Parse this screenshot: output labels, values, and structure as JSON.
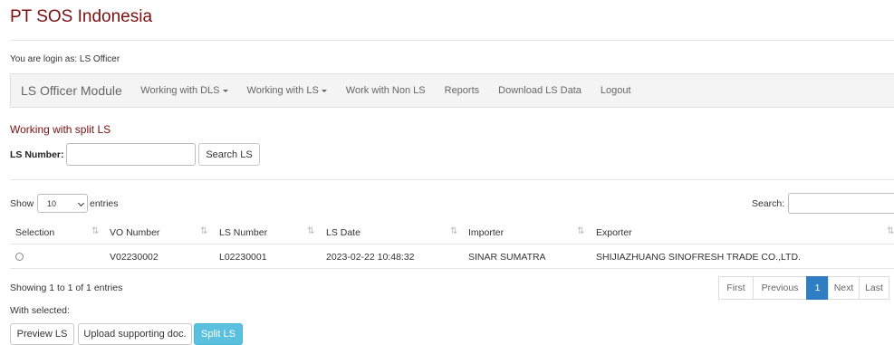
{
  "header": {
    "brand": "PT SOS Indonesia",
    "login_text": "You are login as: LS Officer"
  },
  "nav": {
    "module": "LS Officer Module",
    "items": [
      "Working with DLS",
      "Working with LS",
      "Work with Non LS",
      "Reports",
      "Download LS Data",
      "Logout"
    ]
  },
  "section": {
    "title": "Working with split LS"
  },
  "search_form": {
    "label": "LS Number:",
    "value": "",
    "button": "Search LS"
  },
  "table_controls": {
    "show_label": "Show",
    "page_size": "10",
    "entries_label": "entries",
    "search_label": "Search:",
    "search_value": ""
  },
  "table": {
    "columns": [
      "Selection",
      "VO Number",
      "LS Number",
      "LS Date",
      "Importer",
      "Exporter"
    ],
    "rows": [
      {
        "vo_number": "V02230002",
        "ls_number": "L02230001",
        "ls_date": "2023-02-22 10:48:32",
        "importer": "SINAR SUMATRA",
        "exporter": "SHIJIAZHUANG SINOFRESH TRADE CO.,LTD."
      }
    ]
  },
  "footer": {
    "info": "Showing 1 to 1 of 1 entries",
    "with_selected": "With selected:"
  },
  "pagination": {
    "first": "First",
    "previous": "Previous",
    "current": "1",
    "next": "Next",
    "last": "Last"
  },
  "actions": {
    "preview": "Preview LS",
    "upload": "Upload supporting doc.",
    "split": "Split LS"
  }
}
